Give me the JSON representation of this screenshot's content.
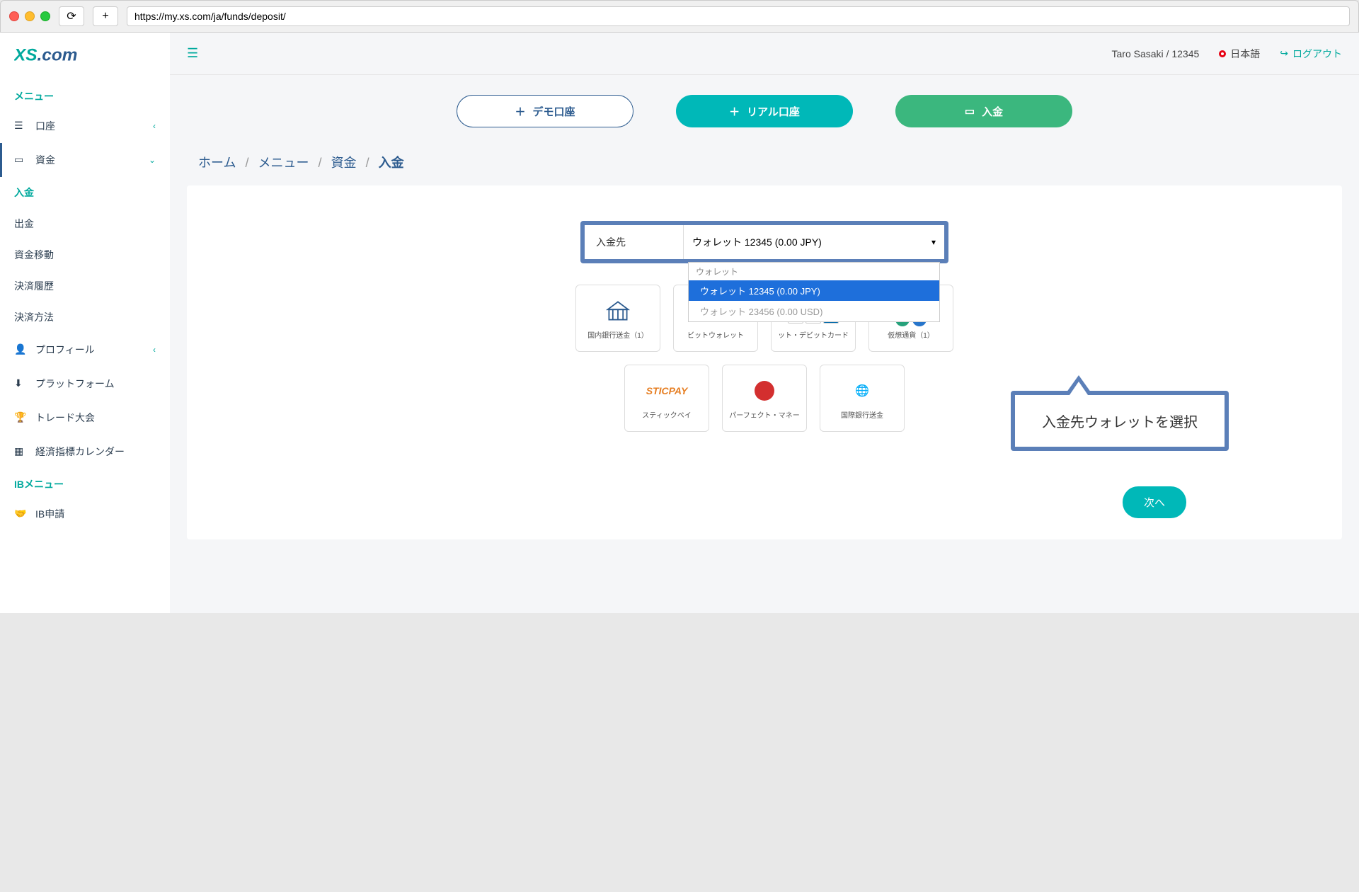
{
  "browser": {
    "url": "https://my.xs.com/ja/funds/deposit/"
  },
  "logo": {
    "text": "XS.com"
  },
  "sidebar": {
    "header1": "メニュー",
    "accounts": "口座",
    "funds": "資金",
    "sub": {
      "deposit": "入金",
      "withdraw": "出金",
      "transfer": "資金移動",
      "history": "決済履歴",
      "methods": "決済方法"
    },
    "profile": "プロフィール",
    "platform": "プラットフォーム",
    "contest": "トレード大会",
    "calendar": "経済指標カレンダー",
    "header2": "IBメニュー",
    "ib": "IB申請"
  },
  "topbar": {
    "user": "Taro Sasaki / 12345",
    "lang": "日本語",
    "logout": "ログアウト"
  },
  "actions": {
    "demo": "デモ口座",
    "real": "リアル口座",
    "deposit": "入金"
  },
  "breadcrumb": {
    "home": "ホーム",
    "menu": "メニュー",
    "funds": "資金",
    "deposit": "入金"
  },
  "form": {
    "dest_label": "入金先",
    "selected": "ウォレット 12345 (0.00 JPY)",
    "group": "ウォレット",
    "options": [
      {
        "label": "ウォレット 12345 (0.00 JPY)",
        "selected": true
      },
      {
        "label": "ウォレット 23456 (0.00 USD)",
        "selected": false
      }
    ]
  },
  "methods": {
    "bank": "国内銀行送金（1）",
    "bitwallet": "ビットウォレット",
    "card": "ット・デビットカード",
    "crypto": "仮想通貨（1）",
    "sticpay": "スティックペイ",
    "perfect": "パーフェクト・マネー",
    "intl_bank": "国際銀行送金",
    "bitwallet_logo": "bitwallet",
    "sticpay_logo": "STICPAY"
  },
  "callout": "入金先ウォレットを選択",
  "next": "次へ"
}
